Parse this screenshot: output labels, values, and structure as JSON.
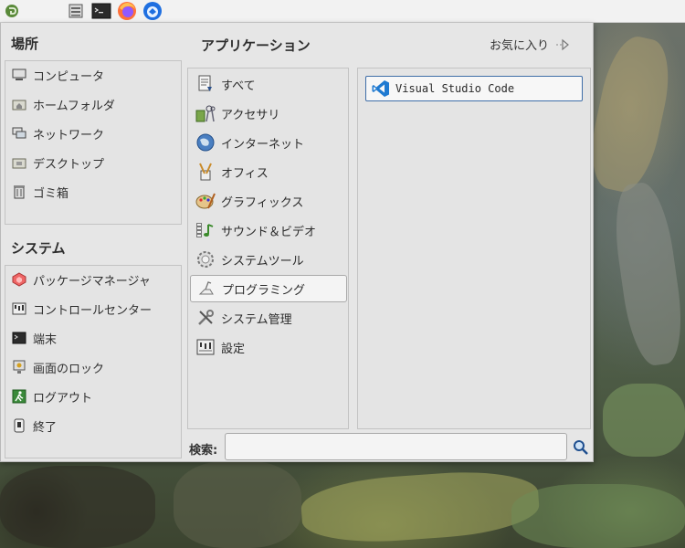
{
  "panel": {
    "launchers": [
      {
        "name": "file-manager-icon"
      },
      {
        "name": "terminal-icon"
      },
      {
        "name": "firefox-icon"
      },
      {
        "name": "thunderbird-icon"
      }
    ]
  },
  "menu": {
    "places_title": "場所",
    "places": [
      {
        "label": "コンピュータ",
        "icon": "computer-icon"
      },
      {
        "label": "ホームフォルダ",
        "icon": "home-folder-icon"
      },
      {
        "label": "ネットワーク",
        "icon": "network-icon"
      },
      {
        "label": "デスクトップ",
        "icon": "desktop-icon"
      },
      {
        "label": "ゴミ箱",
        "icon": "trash-icon"
      }
    ],
    "system_title": "システム",
    "system": [
      {
        "label": "パッケージマネージャ",
        "icon": "package-manager-icon"
      },
      {
        "label": "コントロールセンター",
        "icon": "control-center-icon"
      },
      {
        "label": "端末",
        "icon": "terminal-icon"
      },
      {
        "label": "画面のロック",
        "icon": "lock-screen-icon"
      },
      {
        "label": "ログアウト",
        "icon": "logout-icon"
      },
      {
        "label": "終了",
        "icon": "shutdown-icon"
      }
    ],
    "applications_title": "アプリケーション",
    "favorites_label": "お気に入り",
    "categories": [
      {
        "label": "すべて",
        "icon": "all-applications-icon",
        "selected": false
      },
      {
        "label": "アクセサリ",
        "icon": "accessories-icon",
        "selected": false
      },
      {
        "label": "インターネット",
        "icon": "internet-icon",
        "selected": false
      },
      {
        "label": "オフィス",
        "icon": "office-icon",
        "selected": false
      },
      {
        "label": "グラフィックス",
        "icon": "graphics-icon",
        "selected": false
      },
      {
        "label": "サウンド＆ビデオ",
        "icon": "sound-video-icon",
        "selected": false
      },
      {
        "label": "システムツール",
        "icon": "system-tools-icon",
        "selected": false
      },
      {
        "label": "プログラミング",
        "icon": "programming-icon",
        "selected": true
      },
      {
        "label": "システム管理",
        "icon": "administration-icon",
        "selected": false
      },
      {
        "label": "設定",
        "icon": "preferences-icon",
        "selected": false
      }
    ],
    "apps": [
      {
        "label": "Visual Studio Code",
        "icon": "vscode-icon"
      }
    ],
    "search": {
      "label": "検索:",
      "value": ""
    }
  },
  "colors": {
    "accent": "#3f6ea8",
    "vscode_blue": "#1f7ad1"
  }
}
